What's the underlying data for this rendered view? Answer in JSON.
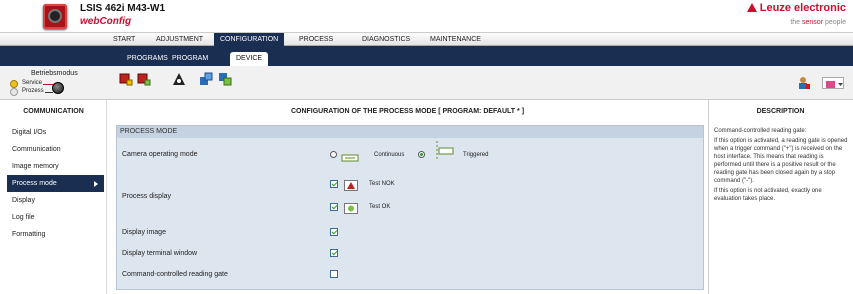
{
  "header": {
    "device_name": "LSIS 462i M43-W1",
    "app_name": "webConfig",
    "brand": "Leuze electronic",
    "tagline_prefix": "the ",
    "tagline_highlight": "sensor",
    "tagline_suffix": " people"
  },
  "topnav": {
    "items": [
      "START",
      "ADJUSTMENT",
      "CONFIGURATION",
      "PROCESS",
      "DIAGNOSTICS",
      "MAINTENANCE"
    ],
    "active": "CONFIGURATION"
  },
  "subnav": {
    "items": [
      "PROGRAMS",
      "PROGRAM",
      "DEVICE"
    ],
    "active": "DEVICE"
  },
  "mode": {
    "title": "Betriebsmodus",
    "service": "Service",
    "process": "Prozess"
  },
  "left": {
    "title": "COMMUNICATION",
    "items": [
      "Digital I/Os",
      "Communication",
      "Image memory",
      "Process mode",
      "Display",
      "Log file",
      "Formatting"
    ],
    "active": "Process mode"
  },
  "center": {
    "title": "CONFIGURATION OF THE PROCESS MODE   [ PROGRAM: DEFAULT * ]",
    "section": "PROCESS MODE",
    "camera_mode_label": "Camera operating mode",
    "continuous_label": "Continuous",
    "triggered_label": "Triggered",
    "process_display_label": "Process display",
    "test_nok_label": "Test NOK",
    "test_ok_label": "Test OK",
    "display_image_label": "Display image",
    "display_terminal_label": "Display terminal window",
    "cmd_gate_label": "Command-controlled reading gate"
  },
  "right": {
    "title": "DESCRIPTION",
    "p1": "Command-controlled reading gate:",
    "p2": "If this option is activated, a reading gate is opened when a trigger command (\"+\") is received on the host interface. This means that reading is performed until there is a positive result or the reading gate has been closed again by a stop command (\"-\").",
    "p3": "If this option is not activated, exactly one evaluation takes place."
  },
  "colors": {
    "navy": "#1a2e52",
    "brand_red": "#c8102e",
    "panel_blue": "#dde5ee",
    "check_green": "#2c9a2c"
  }
}
